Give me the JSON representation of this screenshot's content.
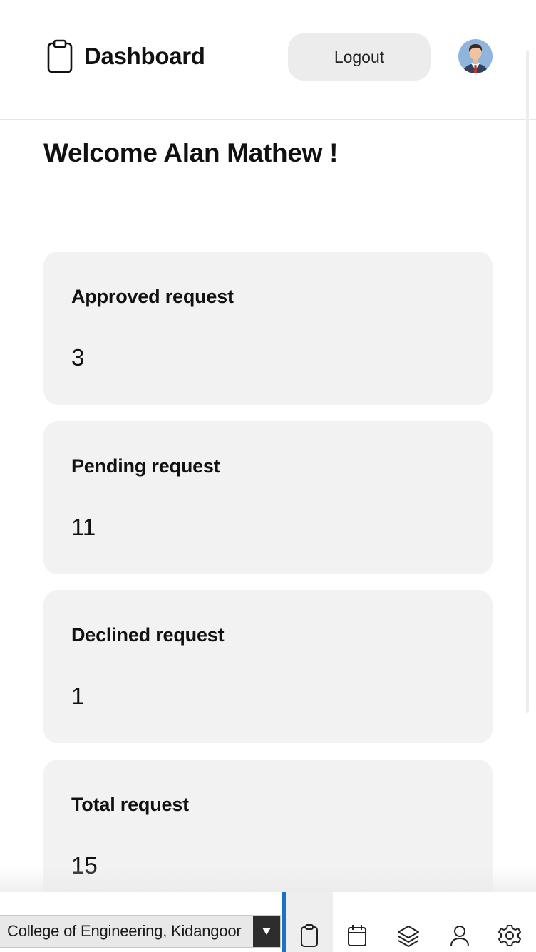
{
  "header": {
    "title": "Dashboard",
    "title_icon": "clipboard-icon",
    "logout_label": "Logout",
    "avatar_icon": "user-avatar"
  },
  "welcome": "Welcome Alan Mathew !",
  "stats": [
    {
      "label": "Approved request",
      "value": "3"
    },
    {
      "label": "Pending request",
      "value": "11"
    },
    {
      "label": "Declined request",
      "value": "1"
    },
    {
      "label": "Total request",
      "value": "15"
    }
  ],
  "footer": {
    "college_select": "College of Engineering, Kidangoor",
    "nav": [
      {
        "icon": "clipboard-icon",
        "active": true
      },
      {
        "icon": "calendar-icon",
        "active": false
      },
      {
        "icon": "layers-icon",
        "active": false
      },
      {
        "icon": "user-icon",
        "active": false
      },
      {
        "icon": "gear-icon",
        "active": false
      }
    ]
  },
  "colors": {
    "accent": "#1a73c9",
    "card_bg": "#f2f2f2",
    "button_bg": "#ececec"
  }
}
